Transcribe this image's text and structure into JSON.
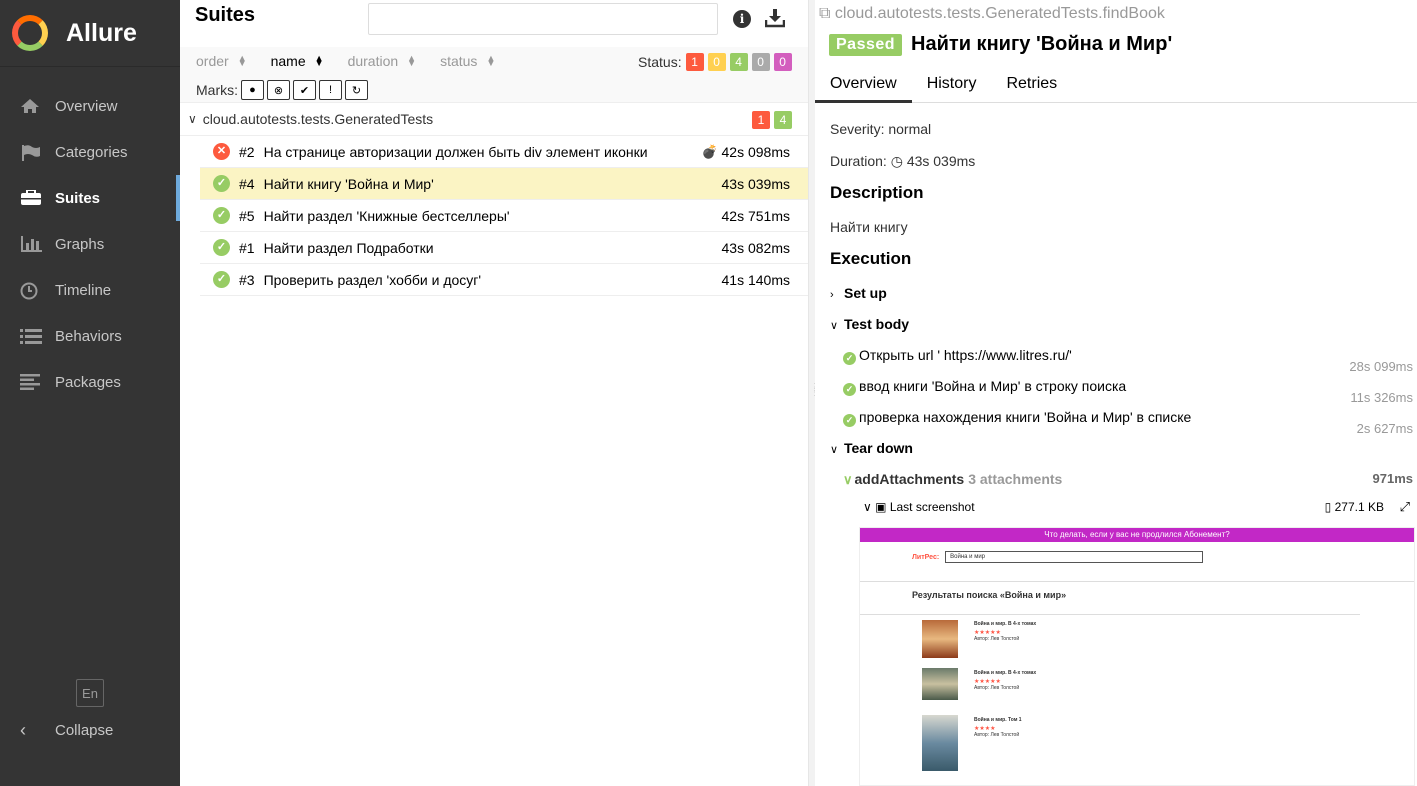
{
  "app": {
    "name": "Allure"
  },
  "sidebar": {
    "items": [
      {
        "label": "Overview",
        "icon": "home-icon"
      },
      {
        "label": "Categories",
        "icon": "flag-icon"
      },
      {
        "label": "Suites",
        "icon": "briefcase-icon",
        "active": true
      },
      {
        "label": "Graphs",
        "icon": "bar-chart-icon"
      },
      {
        "label": "Timeline",
        "icon": "clock-icon"
      },
      {
        "label": "Behaviors",
        "icon": "list-icon"
      },
      {
        "label": "Packages",
        "icon": "align-left-icon"
      }
    ],
    "lang": "En",
    "collapse": "Collapse"
  },
  "suites": {
    "title": "Suites",
    "search_value": "",
    "sort": {
      "order": "order",
      "name": "name",
      "duration": "duration",
      "status": "status"
    },
    "status_label": "Status:",
    "status_counts": {
      "failed": "1",
      "broken": "0",
      "passed": "4",
      "skipped": "0",
      "unknown": "0"
    },
    "marks_label": "Marks:",
    "group": {
      "name": "cloud.autotests.tests.GeneratedTests",
      "failed": "1",
      "passed": "4"
    },
    "rows": [
      {
        "num": "#2",
        "name": "На странице авторизации должен быть div элемент иконки",
        "duration": "42s 098ms",
        "status": "failed",
        "flaky": true
      },
      {
        "num": "#4",
        "name": "Найти книгу 'Война и Мир'",
        "duration": "43s 039ms",
        "status": "passed",
        "selected": true
      },
      {
        "num": "#5",
        "name": "Найти раздел 'Книжные бестселлеры'",
        "duration": "42s 751ms",
        "status": "passed"
      },
      {
        "num": "#1",
        "name": "Найти раздел Подработки",
        "duration": "43s 082ms",
        "status": "passed"
      },
      {
        "num": "#3",
        "name": "Проверить раздел 'хобби и досуг'",
        "duration": "41s 140ms",
        "status": "passed"
      }
    ]
  },
  "detail": {
    "path": "cloud.autotests.tests.GeneratedTests.findBook",
    "status": "Passed",
    "name": "Найти книгу 'Война и Мир'",
    "tabs": [
      "Overview",
      "History",
      "Retries"
    ],
    "severity": "Severity: normal",
    "duration_label": "Duration:",
    "duration": "43s 039ms",
    "description_h": "Description",
    "description": "Найти книгу",
    "execution_h": "Execution",
    "setup": "Set up",
    "test_body": "Test body",
    "steps": [
      {
        "name": "Открыть url ' https://www.litres.ru/'",
        "duration": "28s 099ms"
      },
      {
        "name": "ввод книги 'Война и Мир' в строку поиска",
        "duration": "11s 326ms"
      },
      {
        "name": "проверка нахождения книги 'Война и Мир' в списке",
        "duration": "2s 627ms"
      }
    ],
    "teardown": "Tear down",
    "attachment_step": "addAttachments",
    "attachment_count": "3 attachments",
    "attachment_duration": "971ms",
    "screenshot_name": "Last screenshot",
    "screenshot_size": "277.1 KB",
    "screenshot": {
      "banner": "Что делать, если у вас не продлился Абонемент?",
      "logo": "ЛитРес:",
      "search": "Война и мир",
      "heading": "Результаты поиска «Война и мир»",
      "books": [
        {
          "title": "Война и мир. В 4-х томах",
          "author": "Автор: Лев Толстой"
        },
        {
          "title": "Война и мир. В 4-х томах",
          "author": "Автор: Лев Толстой"
        },
        {
          "title": "Война и мир. Том 1",
          "author": "Автор: Лев Толстой"
        }
      ]
    }
  }
}
